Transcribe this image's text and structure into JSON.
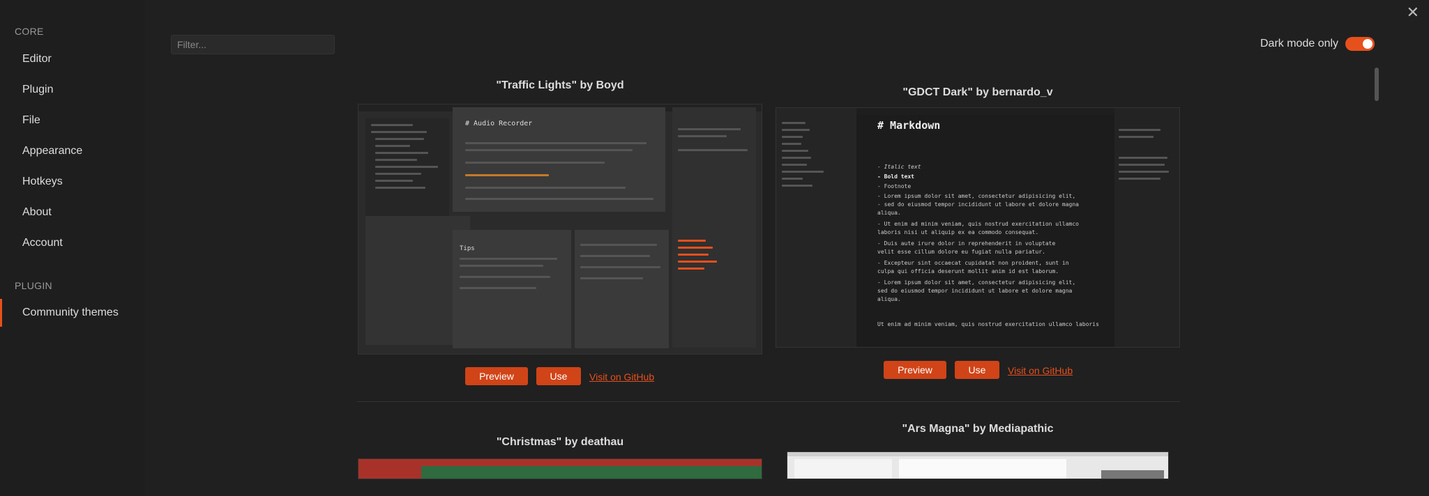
{
  "sidebar": {
    "core_heading": "CORE",
    "core_items": [
      "Editor",
      "Plugin",
      "File",
      "Appearance",
      "Hotkeys",
      "About",
      "Account"
    ],
    "plugin_heading": "PLUGIN",
    "plugin_items": [
      "Community themes"
    ]
  },
  "toolbar": {
    "filter_placeholder": "Filter...",
    "dark_mode_label": "Dark mode only",
    "dark_mode_on": true,
    "close_glyph": "✕"
  },
  "themes": [
    {
      "title": "\"Traffic Lights\" by Boyd",
      "preview": "Preview",
      "use": "Use",
      "github": "Visit on GitHub",
      "shot_heading": "# Audio Recorder",
      "shot_tips": "Tips"
    },
    {
      "title": "\"GDCT Dark\" by bernardo_v",
      "preview": "Preview",
      "use": "Use",
      "github": "Visit on GitHub",
      "shot_heading": "# Markdown",
      "shot_lines": [
        "- Italic text",
        "- Bold text",
        "- Footnote",
        "- Lorem ipsum dolor sit amet, consectetur adipisicing elit,",
        "  - sed do eiusmod tempor incididunt ut labore et dolore magna",
        "    aliqua.",
        "  - Ut enim ad minim veniam, quis nostrud exercitation ullamco",
        "    laboris nisi ut aliquip ex ea commodo consequat.",
        "    - Duis aute irure dolor in reprehenderit in voluptate",
        "      velit esse cillum dolore eu fugiat nulla pariatur.",
        "    - Excepteur sint occaecat cupidatat non proident, sunt in",
        "      culpa qui officia deserunt mollit anim id est laborum.",
        "- Lorem ipsum dolor sit amet, consectetur adipisicing elit,",
        "  sed do eiusmod tempor incididunt ut labore et dolore magna",
        "  aliqua.",
        "Ut enim ad minim veniam, quis nostrud exercitation ullamco laboris"
      ]
    },
    {
      "title": "\"Christmas\" by deathau"
    },
    {
      "title": "\"Ars Magna\" by Mediapathic"
    }
  ]
}
